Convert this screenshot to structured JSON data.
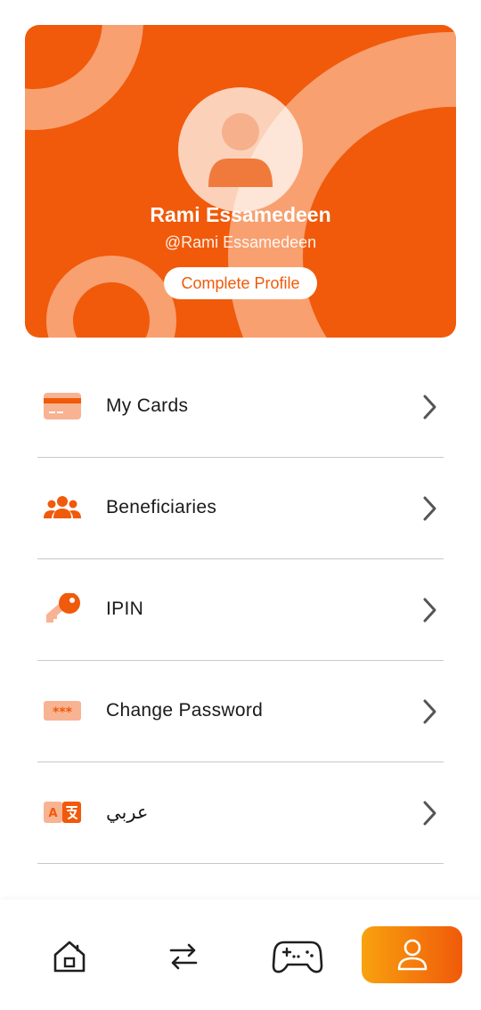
{
  "profile": {
    "name": "Rami Essamedeen",
    "handle": "@Rami Essamedeen",
    "complete_label": "Complete Profile"
  },
  "menu": {
    "items": [
      {
        "label": "My Cards",
        "icon": "card-icon"
      },
      {
        "label": "Beneficiaries",
        "icon": "people-icon"
      },
      {
        "label": "IPIN",
        "icon": "key-icon"
      },
      {
        "label": "Change Password",
        "icon": "password-icon"
      },
      {
        "label": "عربي",
        "icon": "language-icon"
      }
    ]
  },
  "nav": {
    "items": [
      {
        "icon": "home-icon"
      },
      {
        "icon": "transfer-icon"
      },
      {
        "icon": "gamepad-icon"
      },
      {
        "icon": "profile-icon",
        "active": true
      }
    ]
  },
  "colors": {
    "accent": "#f05a0a",
    "accent_light": "#f8a070",
    "gradient_start": "#f8a20e"
  }
}
